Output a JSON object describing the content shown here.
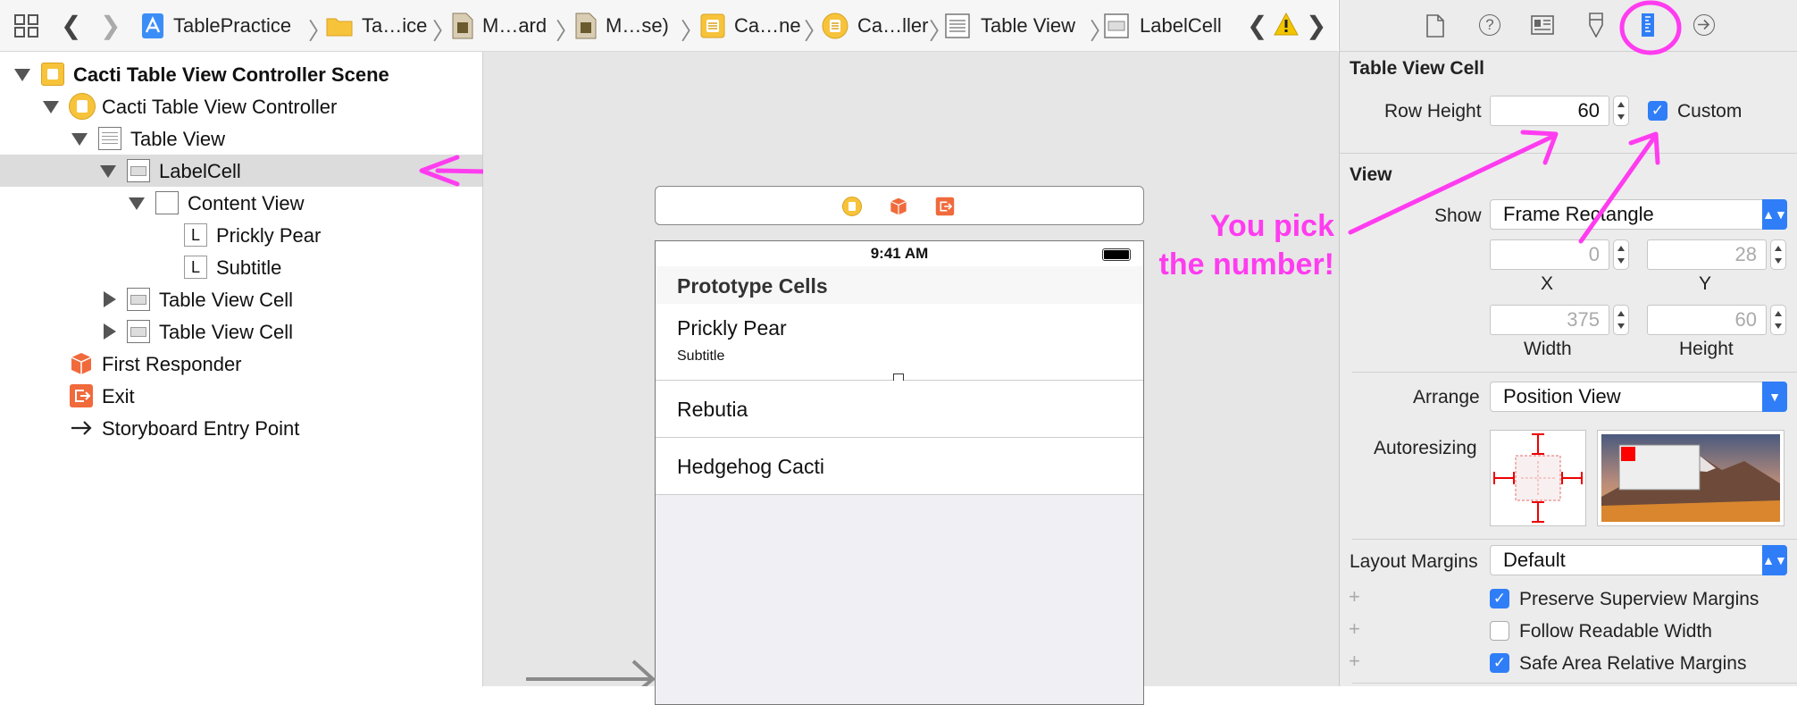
{
  "jumpbar": {
    "crumbs": [
      "TablePractice",
      "Ta…ice",
      "M…ard",
      "M…se)",
      "Ca…ne",
      "Ca…ller",
      "Table View",
      "LabelCell"
    ]
  },
  "outline": {
    "scene": "Cacti Table View Controller Scene",
    "controller": "Cacti Table View Controller",
    "table_view": "Table View",
    "label_cell": "LabelCell",
    "content_view": "Content View",
    "prickly_pear": "Prickly Pear",
    "subtitle": "Subtitle",
    "label_glyph": "L",
    "cell1": "Table View Cell",
    "cell2": "Table View Cell",
    "first_responder": "First Responder",
    "exit": "Exit",
    "entry_point": "Storyboard Entry Point"
  },
  "canvas": {
    "time": "9:41 AM",
    "section_header": "Prototype Cells",
    "cells": [
      {
        "title": "Prickly Pear",
        "subtitle": "Subtitle"
      },
      {
        "title": "Rebutia"
      },
      {
        "title": "Hedgehog Cacti"
      }
    ]
  },
  "inspector": {
    "section1_title": "Table View Cell",
    "row_height_label": "Row Height",
    "row_height_value": "60",
    "custom_label": "Custom",
    "custom_checked": true,
    "section2_title": "View",
    "show_label": "Show",
    "show_value": "Frame Rectangle",
    "x_value": "0",
    "y_value": "28",
    "x_caption": "X",
    "y_caption": "Y",
    "width_value": "375",
    "height_value": "60",
    "width_caption": "Width",
    "height_caption": "Height",
    "arrange_label": "Arrange",
    "arrange_value": "Position View",
    "autoresizing_label": "Autoresizing",
    "layout_margins_label": "Layout Margins",
    "layout_margins_value": "Default",
    "preserve_label": "Preserve Superview Margins",
    "preserve_checked": true,
    "readable_label": "Follow Readable Width",
    "readable_checked": false,
    "safe_area_label": "Safe Area Relative Margins",
    "safe_area_checked": true,
    "plus_glyph": "+"
  },
  "annotation": {
    "line1": "You pick",
    "line2": "the number!"
  },
  "colors": {
    "accent_blue": "#2f7ef7",
    "annotation_pink": "#ff3cf0",
    "warning_yellow": "#f2c500"
  }
}
